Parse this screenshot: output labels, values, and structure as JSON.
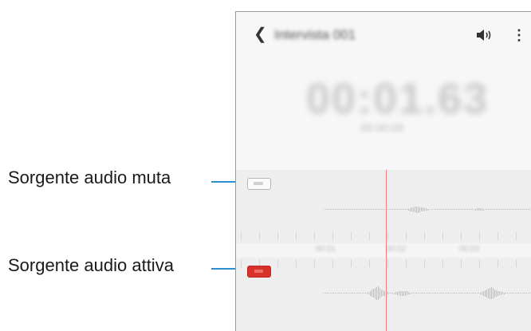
{
  "callouts": {
    "muted": "Sorgente audio muta",
    "active": "Sorgente audio attiva"
  },
  "app": {
    "title": "Intervista 001",
    "elapsed_time": "00:01.63",
    "subtitle": "00:00:00"
  },
  "icons": {
    "back": "back-arrow-icon",
    "speaker": "speaker-icon",
    "more": "more-options-icon"
  },
  "tracks": [
    {
      "state": "muted"
    },
    {
      "state": "active"
    }
  ],
  "ruler_labels": [
    "00:01",
    "00:02",
    "00:03"
  ],
  "colors": {
    "leader_line": "#2a8fd0",
    "active_toggle": "#d8302a",
    "playhead": "#f08080"
  }
}
